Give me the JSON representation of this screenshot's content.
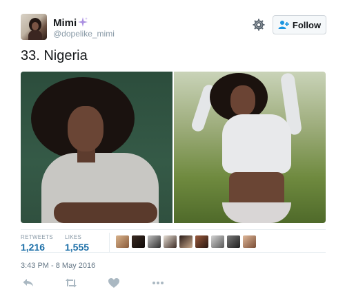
{
  "user": {
    "display_name": "Mimi",
    "handle": "@dopelike_mimi",
    "avatar_icon": "profile-photo",
    "badge_icon": "sparkles-emoji"
  },
  "header": {
    "settings_icon": "gear-icon",
    "follow_label": "Follow"
  },
  "tweet": {
    "text": "33. Nigeria",
    "media": [
      "photo-portrait-green-background",
      "photo-white-crop-top-outdoors"
    ]
  },
  "stats": {
    "retweets_label": "RETWEETS",
    "retweets_value": "1,216",
    "likes_label": "LIKES",
    "likes_value": "1,555",
    "liker_count_shown": 9
  },
  "timestamp": "3:43 PM - 8 May 2016",
  "actions": {
    "reply_icon": "reply-icon",
    "retweet_icon": "retweet-icon",
    "like_icon": "heart-icon",
    "more_icon": "more-icon"
  },
  "colors": {
    "stat_value": "#1c6fa8",
    "muted": "#8899a6",
    "border": "#e6ecf0",
    "sparkle": "#a98ee0"
  }
}
